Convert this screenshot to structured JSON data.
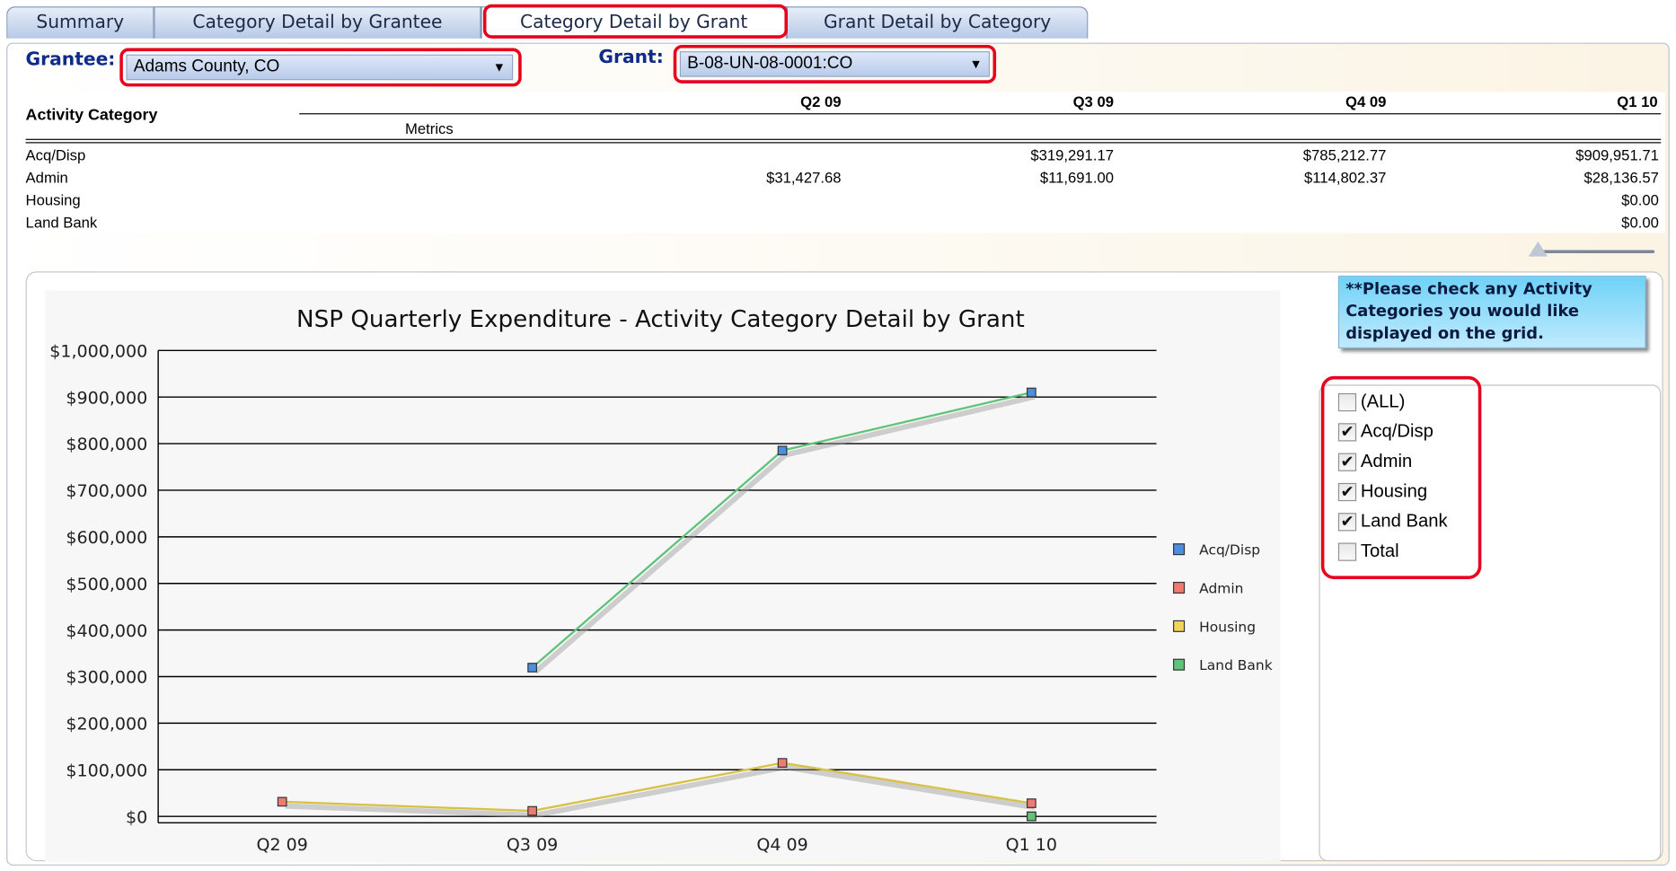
{
  "tabs": [
    {
      "label": "Summary"
    },
    {
      "label": "Category Detail by Grantee"
    },
    {
      "label": "Category Detail by Grant",
      "active": true
    },
    {
      "label": "Grant Detail by Category"
    }
  ],
  "filters": {
    "grantee_label": "Grantee:",
    "grantee_value": "Adams County, CO",
    "grant_label": "Grant:",
    "grant_value": "B-08-UN-08-0001:CO"
  },
  "grid": {
    "header_category": "Activity Category",
    "header_metrics": "Metrics",
    "columns": [
      "Q2 09",
      "Q3 09",
      "Q4 09",
      "Q1 10"
    ],
    "rows": [
      {
        "category": "Acq/Disp",
        "values": [
          "",
          "$319,291.17",
          "$785,212.77",
          "$909,951.71"
        ]
      },
      {
        "category": "Admin",
        "values": [
          "$31,427.68",
          "$11,691.00",
          "$114,802.37",
          "$28,136.57"
        ]
      },
      {
        "category": "Housing",
        "values": [
          "",
          "",
          "",
          "$0.00"
        ]
      },
      {
        "category": "Land Bank",
        "values": [
          "",
          "",
          "",
          "$0.00"
        ]
      }
    ]
  },
  "tooltip": "**Please check any Activity Categories you would like displayed on the grid.",
  "checkboxes": [
    {
      "label": "(ALL)",
      "checked": false
    },
    {
      "label": "Acq/Disp",
      "checked": true
    },
    {
      "label": "Admin",
      "checked": true
    },
    {
      "label": "Housing",
      "checked": true
    },
    {
      "label": "Land Bank",
      "checked": true
    },
    {
      "label": "Total",
      "checked": false
    }
  ],
  "colors": {
    "highlight": "#e8001c",
    "acq_disp": "#4a8fe0",
    "admin": "#ee7b72",
    "housing": "#f2d45c",
    "land_bank": "#5fc47a"
  },
  "chart_data": {
    "type": "line",
    "title": "NSP Quarterly Expenditure - Activity Category Detail by Grant",
    "categories": [
      "Q2 09",
      "Q3 09",
      "Q4 09",
      "Q1 10"
    ],
    "ylim": [
      0,
      1000000
    ],
    "yticks": [
      0,
      100000,
      200000,
      300000,
      400000,
      500000,
      600000,
      700000,
      800000,
      900000,
      1000000
    ],
    "ytick_labels": [
      "$0",
      "$100,000",
      "$200,000",
      "$300,000",
      "$400,000",
      "$500,000",
      "$600,000",
      "$700,000",
      "$800,000",
      "$900,000",
      "$1,000,000"
    ],
    "grid": true,
    "legend_position": "right",
    "series": [
      {
        "name": "Acq/Disp",
        "values": [
          null,
          319291.17,
          785212.77,
          909951.71
        ],
        "color": "#4a8fe0",
        "line_color": "#5fc47a"
      },
      {
        "name": "Admin",
        "values": [
          31427.68,
          11691.0,
          114802.37,
          28136.57
        ],
        "color": "#ee7b72",
        "line_color": "#d8c246"
      },
      {
        "name": "Housing",
        "values": [
          null,
          null,
          null,
          0
        ],
        "color": "#f2d45c",
        "line_color": "#d8c246"
      },
      {
        "name": "Land Bank",
        "values": [
          null,
          null,
          null,
          0
        ],
        "color": "#5fc47a",
        "line_color": "#5fc47a"
      }
    ]
  }
}
